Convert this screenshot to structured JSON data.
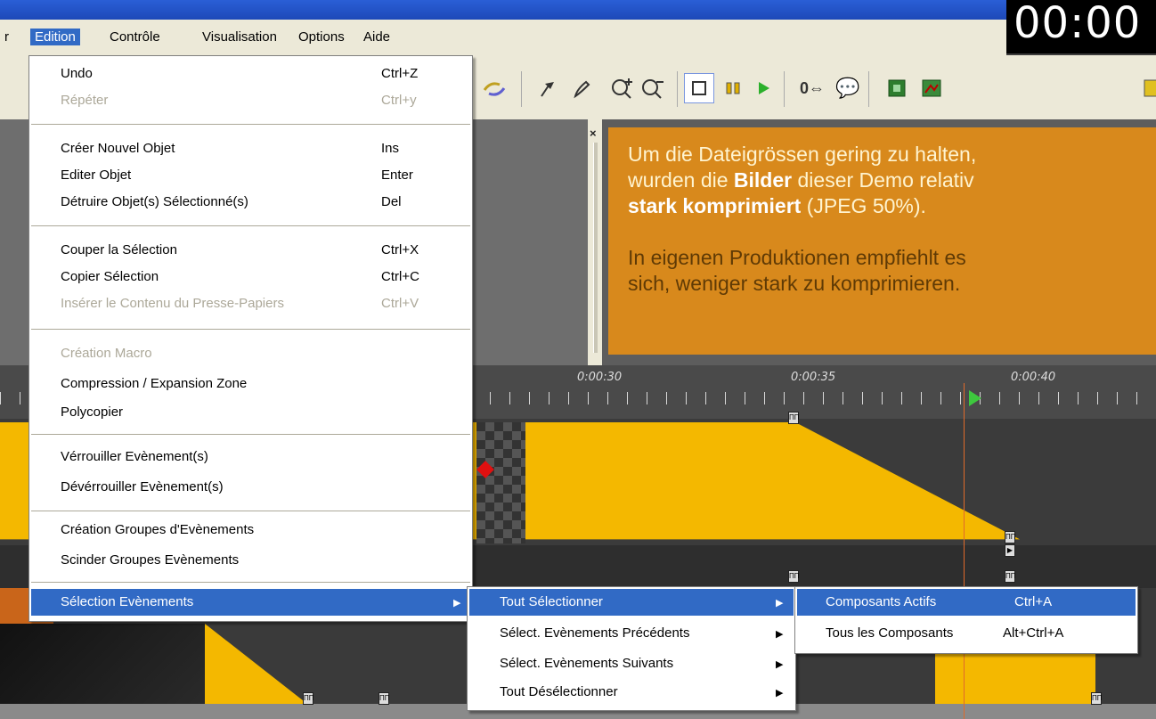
{
  "clock": "00:00",
  "menubar": {
    "items": [
      {
        "label": "r"
      },
      {
        "label": "Edition"
      },
      {
        "label": "Contrôle"
      },
      {
        "label": "Visualisation"
      },
      {
        "label": "Options"
      },
      {
        "label": "Aide"
      }
    ]
  },
  "notice": {
    "line1": "Um die Dateigrössen gering zu halten,",
    "line2a": "wurden die ",
    "line2b": "Bilder",
    "line2c": " dieser Demo relativ",
    "line3a": "stark komprimiert",
    "line3b": " (JPEG 50%).",
    "line4": "In eigenen Produktionen empfiehlt es",
    "line5": "sich, weniger stark zu komprimieren."
  },
  "timeline": {
    "labels": [
      "0:00:30",
      "0:00:35",
      "0:00:40"
    ]
  },
  "edit_menu": {
    "undo": {
      "label": "Undo",
      "shortcut": "Ctrl+Z"
    },
    "redo": {
      "label": "Répéter",
      "shortcut": "Ctrl+y"
    },
    "create": {
      "label": "Créer Nouvel Objet",
      "shortcut": "Ins"
    },
    "edit": {
      "label": "Editer Objet",
      "shortcut": "Enter"
    },
    "delete": {
      "label": "Détruire Objet(s) Sélectionné(s)",
      "shortcut": "Del"
    },
    "cut": {
      "label": "Couper la Sélection",
      "shortcut": "Ctrl+X"
    },
    "copy": {
      "label": "Copier Sélection",
      "shortcut": "Ctrl+C"
    },
    "paste": {
      "label": "Insérer le Contenu du Presse-Papiers",
      "shortcut": "Ctrl+V"
    },
    "macro": {
      "label": "Création Macro"
    },
    "compress": {
      "label": "Compression / Expansion Zone"
    },
    "polycopy": {
      "label": "Polycopier"
    },
    "lock": {
      "label": "Vérrouiller Evènement(s)"
    },
    "unlock": {
      "label": "Dévérrouiller Evènement(s)"
    },
    "group": {
      "label": "Création Groupes d'Evènements"
    },
    "split": {
      "label": "Scinder Groupes Evènements"
    },
    "select_events": {
      "label": "Sélection Evènements"
    }
  },
  "submenu1": {
    "items": [
      {
        "label": "Tout Sélectionner"
      },
      {
        "label": "Sélect. Evènements Précédents"
      },
      {
        "label": "Sélect. Evènements Suivants"
      },
      {
        "label": "Tout Désélectionner"
      }
    ]
  },
  "submenu2": {
    "items": [
      {
        "label": "Composants Actifs",
        "shortcut": "Ctrl+A"
      },
      {
        "label": "Tous les Composants",
        "shortcut": "Alt+Ctrl+A"
      }
    ]
  },
  "colors": {
    "highlight": "#316ac5",
    "notice_bg": "#d8891c",
    "event_yellow": "#f4b800",
    "menu_bg": "#ece9d8"
  }
}
